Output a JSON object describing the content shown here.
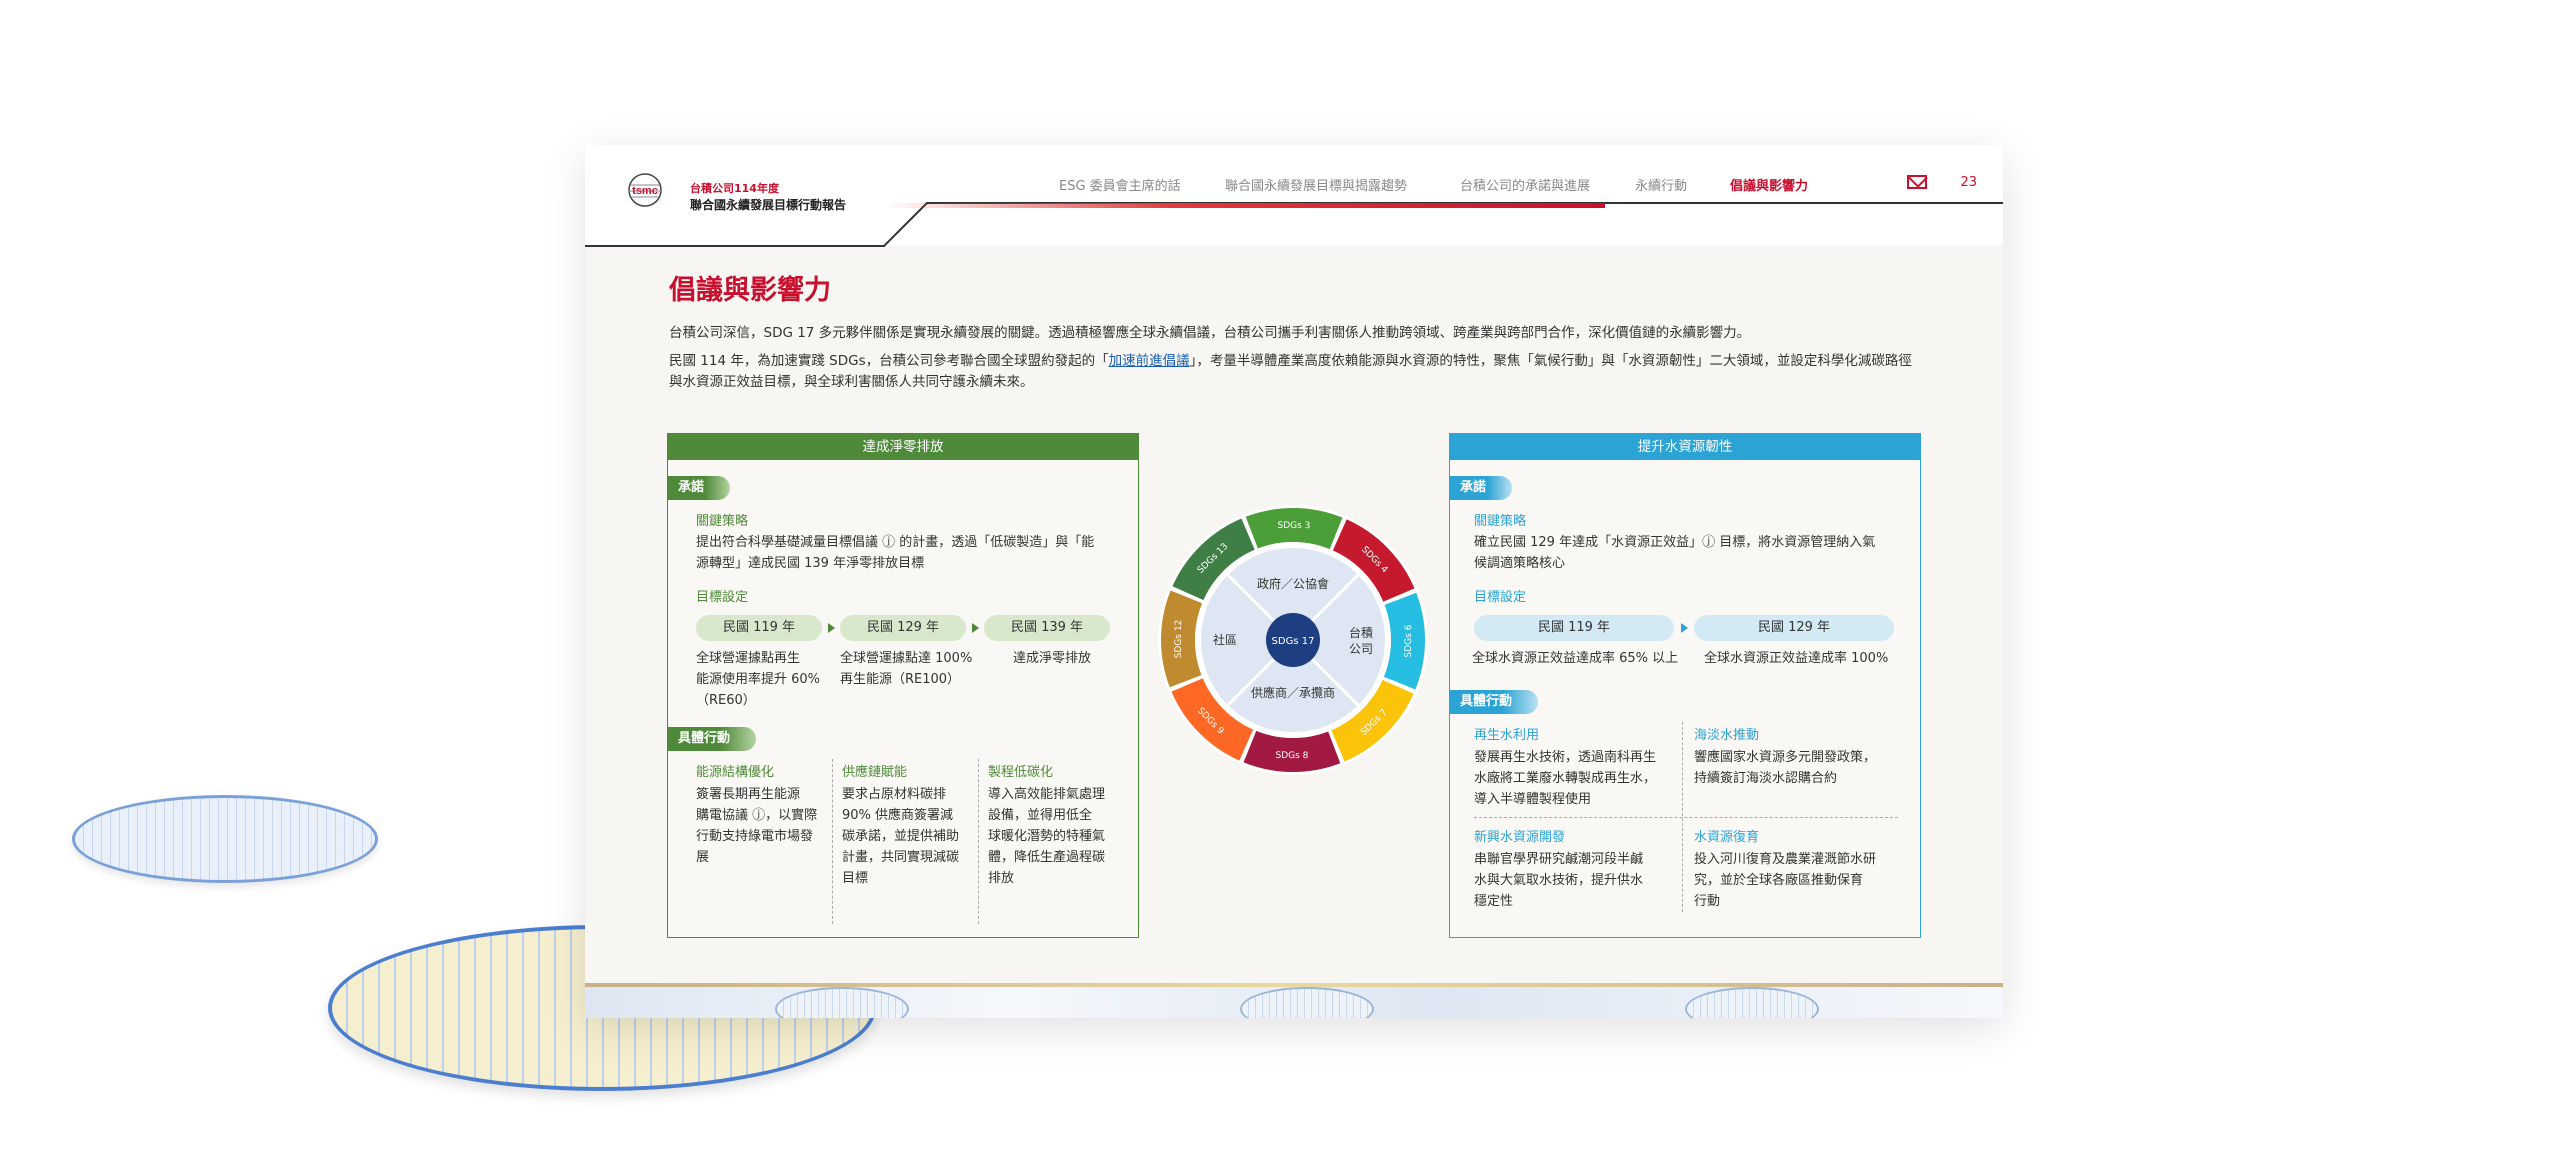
{
  "header": {
    "brand_line1": "台積公司114年度",
    "brand_line2": "聯合國永續發展目標行動報告",
    "nav": [
      "ESG 委員會主席的話",
      "聯合國永續發展目標與揭露趨勢",
      "台積公司的承諾與進展",
      "永續行動",
      "倡議與影響力"
    ],
    "active_nav": "倡議與影響力",
    "page_number": "23"
  },
  "title": "倡議與影響力",
  "intro": {
    "p1": "台積公司深信，SDG 17 多元夥伴關係是實現永續發展的關鍵。透過積極響應全球永續倡議，台積公司攜手利害關係人推動跨領域、跨產業與跨部門合作，深化價值鏈的永續影響力。",
    "p2_before": "民國 114 年，為加速實踐 SDGs，台積公司參考聯合國全球盟約發起的「",
    "p2_link": "加速前進倡議",
    "p2_after": "」，考量半導體產業高度依賴能源與水資源的特性，聚焦「氣候行動」與「水資源韌性」二大領域，並設定科學化減碳路徑與水資源正效益目標，與全球利害關係人共同守護永續未來。"
  },
  "left_panel": {
    "title": "達成淨零排放",
    "commit_tag": "承諾",
    "strategy_label": "關鍵策略",
    "strategy_text_1": "提出符合科學基礎減量目標倡議 ⓙ 的計畫，透過「低碳製造」與「能",
    "strategy_text_2": "源轉型」達成民國 139 年淨零排放目標",
    "target_label": "目標設定",
    "milestones": [
      {
        "year": "民國 119 年",
        "desc1": "全球營運據點再生",
        "desc2": "能源使用率提升 60%",
        "desc3": "（RE60）"
      },
      {
        "year": "民國 129 年",
        "desc1": "全球營運據點達 100%",
        "desc2": "再生能源（RE100）",
        "desc3": ""
      },
      {
        "year": "民國 139 年",
        "desc1": "達成淨零排放",
        "desc2": "",
        "desc3": ""
      }
    ],
    "action_tag": "具體行動",
    "actions": [
      {
        "title": "能源結構優化",
        "lines": [
          "簽署長期再生能源",
          "購電協議 ⓙ，以實際",
          "行動支持綠電市場發",
          "展"
        ]
      },
      {
        "title": "供應鏈賦能",
        "lines": [
          "要求占原材料碳排",
          "90% 供應商簽署減",
          "碳承諾，並提供補助",
          "計畫，共同實現減碳",
          "目標"
        ]
      },
      {
        "title": "製程低碳化",
        "lines": [
          "導入高效能排氣處理",
          "設備，並得用低全",
          "球暖化潛勢的特種氣",
          "體，降低生產過程碳",
          "排放"
        ]
      }
    ]
  },
  "right_panel": {
    "title": "提升水資源韌性",
    "commit_tag": "承諾",
    "strategy_label": "關鍵策略",
    "strategy_text_1": "確立民國 129 年達成「水資源正效益」ⓙ 目標，將水資源管理納入氣",
    "strategy_text_2": "候調適策略核心",
    "target_label": "目標設定",
    "milestones": [
      {
        "year": "民國 119 年",
        "desc": "全球水資源正效益達成率 65% 以上"
      },
      {
        "year": "民國 129 年",
        "desc": "全球水資源正效益達成率 100%"
      }
    ],
    "action_tag": "具體行動",
    "actions": [
      {
        "title": "再生水利用",
        "lines": [
          "發展再生水技術，透過南科再生",
          "水廠將工業廢水轉製成再生水，",
          "導入半導體製程使用"
        ]
      },
      {
        "title": "海淡水推動",
        "lines": [
          "響應國家水資源多元開發政策，",
          "持續簽訂海淡水認購合約"
        ]
      },
      {
        "title": "新興水資源開發",
        "lines": [
          "串聯官學界研究鹹潮河段半鹹",
          "水與大氣取水技術，提升供水",
          "穩定性"
        ]
      },
      {
        "title": "水資源復育",
        "lines": [
          "投入河川復育及農業灌溉節水研",
          "究，並於全球各廠區推動保育",
          "行動"
        ]
      }
    ]
  },
  "wheel": {
    "center": "SDGs 17",
    "inner": [
      "政府／公協會",
      "台積公司",
      "供應商／承攬商",
      "社區"
    ],
    "outer": [
      "SDGs 3",
      "SDGs 4",
      "SDGs 6",
      "SDGs 7",
      "SDGs 8",
      "SDGs 9",
      "SDGs 12",
      "SDGs 13"
    ]
  },
  "colors": {
    "brand_red": "#c8102e",
    "green": "#4f8a3a",
    "blue": "#2ba3d4"
  }
}
